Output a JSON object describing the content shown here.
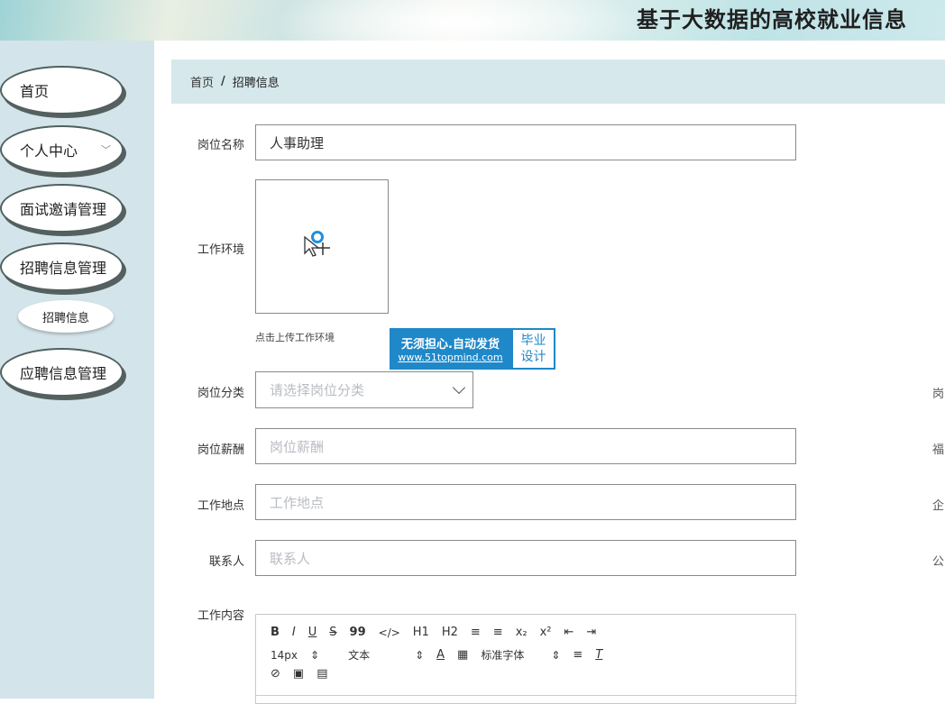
{
  "header": {
    "title": "基于大数据的高校就业信息"
  },
  "sidebar": {
    "items": [
      {
        "label": "首页"
      },
      {
        "label": "个人中心"
      },
      {
        "label": "面试邀请管理"
      },
      {
        "label": "招聘信息管理"
      },
      {
        "label": "应聘信息管理"
      }
    ],
    "sub_item": {
      "label": "招聘信息"
    }
  },
  "breadcrumb": {
    "home": "首页",
    "separator": "/",
    "current": "招聘信息"
  },
  "form": {
    "job_name": {
      "label": "岗位名称",
      "value": "人事助理"
    },
    "work_env": {
      "label": "工作环境",
      "hint": "点击上传工作环境"
    },
    "job_category": {
      "label": "岗位分类",
      "placeholder": "请选择岗位分类"
    },
    "salary": {
      "label": "岗位薪酬",
      "placeholder": "岗位薪酬"
    },
    "location": {
      "label": "工作地点",
      "placeholder": "工作地点"
    },
    "contact": {
      "label": "联系人",
      "placeholder": "联系人"
    },
    "content": {
      "label": "工作内容"
    }
  },
  "right_labels": [
    "岗",
    "福",
    "企",
    "公"
  ],
  "watermark": {
    "line1": "无须担心.自动发货",
    "line2": "www.51topmind.com",
    "tag1": "毕业",
    "tag2": "设计"
  },
  "editor": {
    "row1": [
      "B",
      "I",
      "U",
      "S",
      "99",
      "</>",
      "H1",
      "H2",
      "≡",
      "≡",
      "x₂",
      "x²",
      "⇤",
      "⇥"
    ],
    "font_size": "14px",
    "text_type": "文本",
    "font_family": "标准字体"
  }
}
